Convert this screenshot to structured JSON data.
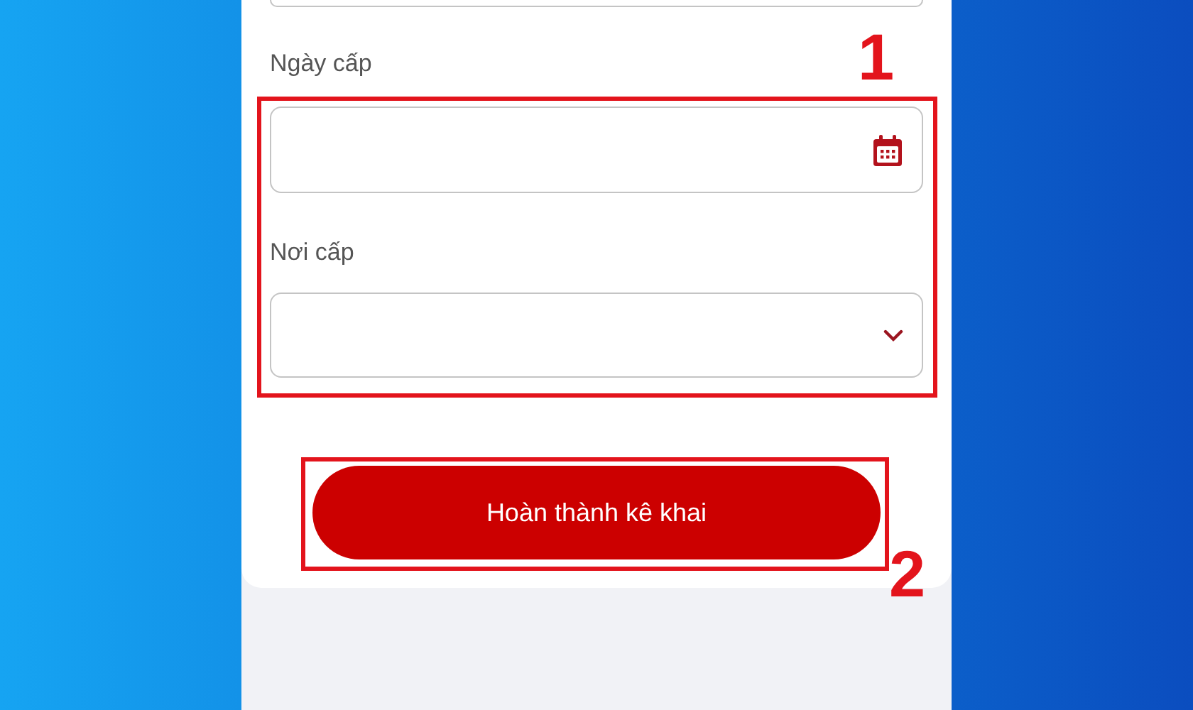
{
  "form": {
    "fields": [
      {
        "label": "Ngày cấp",
        "kind": "date"
      },
      {
        "label": "Nơi cấp",
        "kind": "select"
      }
    ],
    "submit_button": "Hoàn thành kê khai"
  },
  "annotations": [
    {
      "label": "1"
    },
    {
      "label": "2"
    }
  ]
}
